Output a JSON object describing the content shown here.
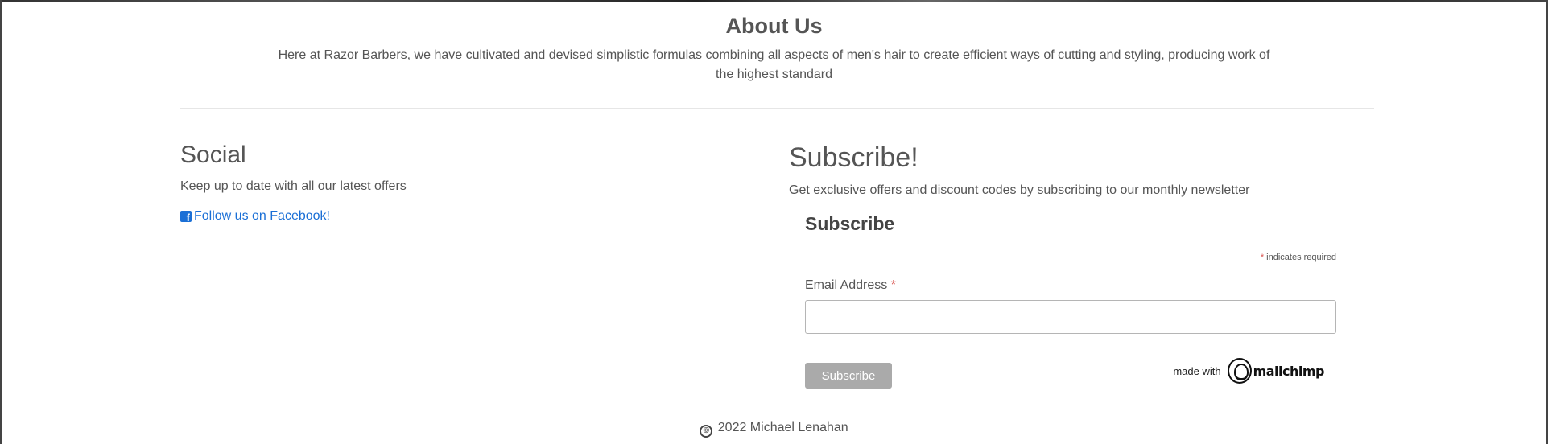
{
  "about": {
    "title": "About Us",
    "text": "Here at Razor Barbers, we have cultivated and devised simplistic formulas combining all aspects of men's hair to create efficient ways of cutting and styling, producing work of the highest standard"
  },
  "social": {
    "title": "Social",
    "text": "Keep up to date with all our latest offers",
    "facebook_link": "Follow us on Facebook!",
    "facebook_icon": "facebook-square-icon"
  },
  "subscribe": {
    "title": "Subscribe!",
    "text": "Get exclusive offers and discount codes by subscribing to our monthly newsletter",
    "form": {
      "title": "Subscribe",
      "required_asterisk": "*",
      "required_note": " indicates required",
      "email_label": "Email Address",
      "email_value": "",
      "button_label": "Subscribe",
      "made_with": "made with",
      "brand": "mailchimp",
      "brand_icon": "mailchimp-freddie-icon"
    }
  },
  "footer": {
    "copyright_icon": "©",
    "text": "2022 Michael Lenahan"
  },
  "colors": {
    "link": "#1a6fd6",
    "required": "#d9534f",
    "button_bg": "#aaaaaa",
    "text": "#555555"
  }
}
